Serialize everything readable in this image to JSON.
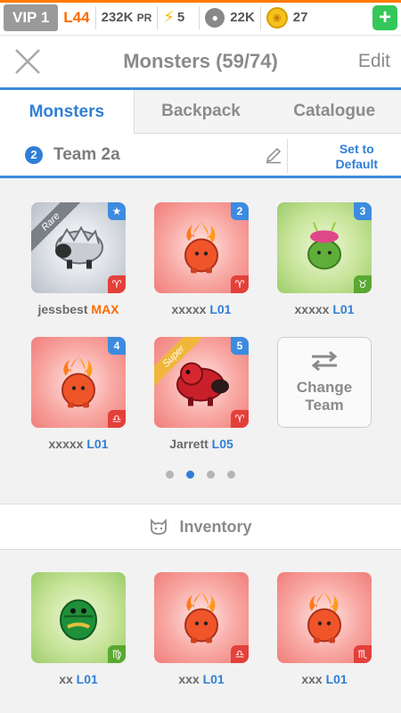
{
  "status": {
    "vip": "VIP 1",
    "level": "L44",
    "pr_value": "232K",
    "pr_unit": "PR",
    "energy": "5",
    "food": "22K",
    "coins": "27",
    "add": "+"
  },
  "header": {
    "title": "Monsters (59/74)",
    "edit": "Edit"
  },
  "tabs": [
    {
      "label": "Monsters",
      "active": true
    },
    {
      "label": "Backpack",
      "active": false
    },
    {
      "label": "Catalogue",
      "active": false
    }
  ],
  "team": {
    "number": "2",
    "name": "Team 2a",
    "set_default_line1": "Set to",
    "set_default_line2": "Default"
  },
  "team_monsters": [
    {
      "name": "jessbest",
      "level": "MAX",
      "badge": "★",
      "ribbon": "Rare",
      "zodiac": "♈",
      "color": "gray"
    },
    {
      "name": "xxxxx",
      "level": "L01",
      "badge": "2",
      "ribbon": "",
      "zodiac": "♈",
      "color": "red"
    },
    {
      "name": "xxxxx",
      "level": "L01",
      "badge": "3",
      "ribbon": "",
      "zodiac": "♉",
      "color": "green"
    },
    {
      "name": "xxxxx",
      "level": "L01",
      "badge": "4",
      "ribbon": "",
      "zodiac": "♎",
      "color": "red"
    },
    {
      "name": "Jarrett",
      "level": "L05",
      "badge": "5",
      "ribbon": "Super",
      "zodiac": "♈",
      "color": "red"
    }
  ],
  "change_team": {
    "line1": "Change",
    "line2": "Team"
  },
  "pager": {
    "count": 4,
    "active": 1
  },
  "inventory": {
    "title": "Inventory",
    "items": [
      {
        "name": "xx",
        "level": "L01",
        "zodiac": "♍",
        "color": "green"
      },
      {
        "name": "xxx",
        "level": "L01",
        "zodiac": "♎",
        "color": "red"
      },
      {
        "name": "xxx",
        "level": "L01",
        "zodiac": "♏",
        "color": "red"
      }
    ]
  },
  "colors": {
    "accent": "#2f7fd6",
    "orange": "#ff6a00",
    "green_button": "#34c759"
  }
}
